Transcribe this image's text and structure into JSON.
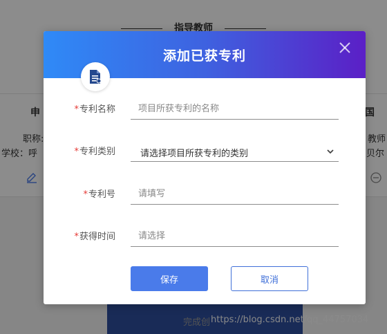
{
  "background": {
    "section_heading": "指导教师",
    "left_card": {
      "name": "申",
      "title_line": "职称:",
      "school_line": "学校：呼"
    },
    "right_card": {
      "name": "国",
      "title_line": "教师",
      "school_line": "贝尔"
    },
    "bottom_button_label": "完成创",
    "watermark": "https://blog.csdn.net/qq_44757034"
  },
  "dialog": {
    "title": "添加已获专利",
    "badge_icon": "document-icon",
    "close_icon": "close-icon",
    "required_mark": "*",
    "fields": [
      {
        "label": "专利名称",
        "required": true,
        "type": "text",
        "value": "",
        "placeholder": "项目所获专利的名称"
      },
      {
        "label": "专利类别",
        "required": true,
        "type": "select",
        "selected": "请选择项目所获专利的类别"
      },
      {
        "label": "专利号",
        "required": true,
        "type": "text",
        "value": "",
        "placeholder": "请填写"
      },
      {
        "label": "获得时间",
        "required": true,
        "type": "text",
        "value": "",
        "placeholder": "请选择"
      }
    ],
    "buttons": {
      "save": "保存",
      "cancel": "取消"
    }
  },
  "colors": {
    "header_gradient_start": "#2f8af7",
    "header_gradient_end": "#5b1fc6",
    "primary": "#4a7bea",
    "required": "#e53935"
  }
}
